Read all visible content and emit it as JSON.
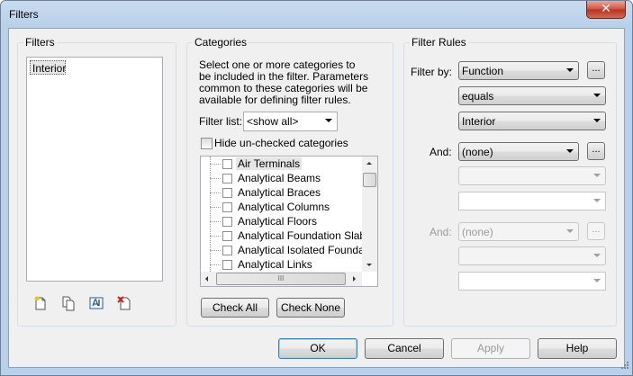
{
  "window": {
    "title": "Filters",
    "close_glyph": "✕"
  },
  "filters_panel": {
    "legend": "Filters",
    "items": [
      "Interior"
    ],
    "toolbar_icons": [
      "new-filter-icon",
      "duplicate-filter-icon",
      "rename-filter-icon",
      "delete-filter-icon"
    ]
  },
  "categories_panel": {
    "legend": "Categories",
    "description": "Select one or more categories to be included in the filter.  Parameters common to these categories will be available for defining filter rules.",
    "filter_list_label": "Filter list:",
    "filter_list_value": "<show all>",
    "hide_unchecked_label": "Hide un-checked categories",
    "items": [
      "Air Terminals",
      "Analytical Beams",
      "Analytical Braces",
      "Analytical Columns",
      "Analytical Floors",
      "Analytical Foundation Slabs",
      "Analytical Isolated Foundati...",
      "Analytical Links"
    ],
    "hscroll_grip": "III",
    "check_all": "Check All",
    "check_none": "Check None"
  },
  "filter_rules_panel": {
    "legend": "Filter Rules",
    "filter_by_label": "Filter by:",
    "filter_by_value": "Function",
    "operator_value": "equals",
    "value_value": "Interior",
    "and1_label": "And:",
    "and1_value": "(none)",
    "and2_label": "And:",
    "and2_value": "(none)",
    "ellipsis": "..."
  },
  "footer": {
    "ok": "OK",
    "cancel": "Cancel",
    "apply": "Apply",
    "help": "Help"
  }
}
